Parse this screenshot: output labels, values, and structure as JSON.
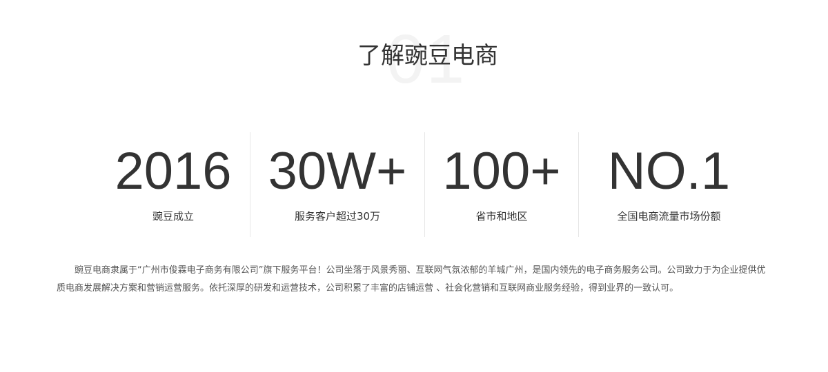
{
  "section": {
    "number": "01",
    "title": "了解豌豆电商"
  },
  "stats": [
    {
      "value": "2016",
      "label": "豌豆成立"
    },
    {
      "value": "30W+",
      "label": "服务客户超过30万"
    },
    {
      "value": "100+",
      "label": "省市和地区"
    },
    {
      "value": "NO.1",
      "label": "全国电商流量市场份额"
    }
  ],
  "intro": {
    "text": "豌豆电商隶属于“广州市俊霖电子商务有限公司”旗下服务平台！公司坐落于风景秀丽、互联网气氛浓郁的羊城广州，是国内领先的电子商务服务公司。公司致力于为企业提供优质电商发展解决方案和营销运营服务。依托深厚的研发和运营技术，公司积累了丰富的店铺运营 、社会化营销和互联网商业服务经验，得到业界的一致认可。"
  }
}
